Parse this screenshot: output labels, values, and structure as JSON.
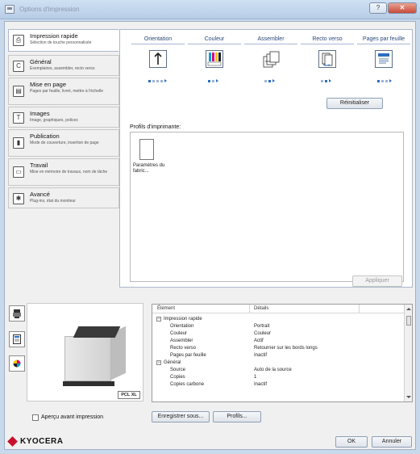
{
  "window": {
    "title": "Options d'impression",
    "help_label": "?",
    "close_label": "✕"
  },
  "nav": {
    "items": [
      {
        "title": "Impression rapide",
        "subtitle": "Sélection de touche personnalisée",
        "icon": "quick-print-icon"
      },
      {
        "title": "Général",
        "subtitle": "Exemplaires, assembler, recto verso",
        "icon": "general-icon"
      },
      {
        "title": "Mise en page",
        "subtitle": "Pages par feuille, livret, mettre à l'échelle",
        "icon": "layout-icon"
      },
      {
        "title": "Images",
        "subtitle": "Image, graphiques, polices",
        "icon": "images-icon"
      },
      {
        "title": "Publication",
        "subtitle": "Mode de couverture, insertion de page",
        "icon": "publication-icon"
      },
      {
        "title": "Travail",
        "subtitle": "Mise en mémoire de travaux, nom de tâche",
        "icon": "job-icon"
      },
      {
        "title": "Avancé",
        "subtitle": "Plug-ins, état du moniteur",
        "icon": "advanced-icon"
      }
    ]
  },
  "quick_print": {
    "columns": [
      "Orientation",
      "Couleur",
      "Assembler",
      "Recto verso",
      "Pages par feuille"
    ],
    "reset_label": "Réinitialiser",
    "profiles_label": "Profils d'imprimante:",
    "profile_name": "Paramètres du fabric...",
    "apply_label": "Appliquer"
  },
  "preview": {
    "pcl_badge": "PCL XL"
  },
  "details": {
    "headers": [
      "Élément",
      "Détails"
    ],
    "rows": [
      {
        "key": "Impression rapide",
        "value": "",
        "group": true,
        "expander": "−"
      },
      {
        "key": "Orientation",
        "value": "Portrait"
      },
      {
        "key": "Couleur",
        "value": "Couleur"
      },
      {
        "key": "Assembler",
        "value": "Actif"
      },
      {
        "key": "Recto verso",
        "value": "Retourner sur les bords longs"
      },
      {
        "key": "Pages par feuille",
        "value": "Inactif"
      },
      {
        "key": "Général",
        "value": "",
        "group": true,
        "expander": "−"
      },
      {
        "key": "Source",
        "value": "Auto de la source"
      },
      {
        "key": "Copies",
        "value": "1"
      },
      {
        "key": "Copies carbone",
        "value": "Inactif"
      }
    ]
  },
  "footer": {
    "preview_checkbox_label": "Aperçu avant impression",
    "save_as_label": "Enregistrer sous...",
    "profiles_label": "Profils...",
    "brand": "KYOCERA",
    "ok_label": "OK",
    "cancel_label": "Annuler"
  },
  "colors": {
    "accent": "#2d6fbf",
    "brand_red": "#c8102e"
  }
}
